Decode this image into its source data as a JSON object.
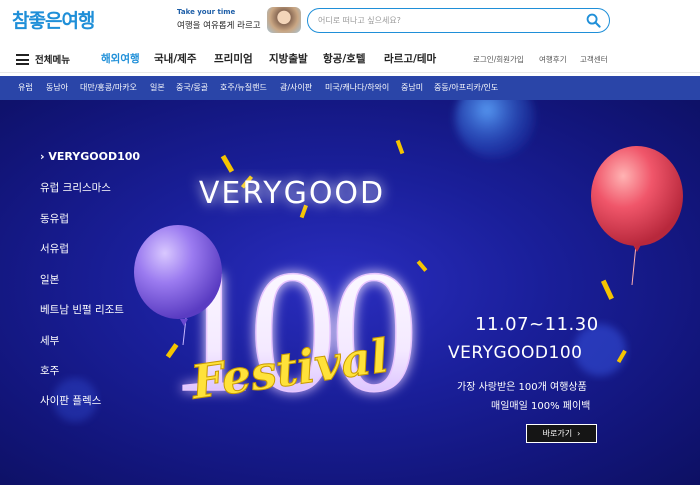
{
  "header": {
    "logo": "참좋은여행",
    "promo_small": "Take your time",
    "promo_main": "여행을 여유롭게 라르고",
    "search_placeholder": "어디로 떠나고 싶으세요?"
  },
  "nav": {
    "all_menu": "전체메뉴",
    "items": [
      {
        "label": "해외여행"
      },
      {
        "label": "국내/제주"
      },
      {
        "label": "프리미엄"
      },
      {
        "label": "지방출발"
      },
      {
        "label": "항공/호텔"
      },
      {
        "label": "라르고/테마"
      }
    ],
    "util": [
      {
        "label": "로그인/회원가입"
      },
      {
        "label": "여행후기"
      },
      {
        "label": "고객센터"
      }
    ]
  },
  "subnav": {
    "items": [
      {
        "label": "유럽"
      },
      {
        "label": "동남아"
      },
      {
        "label": "대만/홍콩/마카오"
      },
      {
        "label": "일본"
      },
      {
        "label": "중국/몽골"
      },
      {
        "label": "호주/뉴질랜드"
      },
      {
        "label": "괌/사이판"
      },
      {
        "label": "미국/캐나다/하와이"
      },
      {
        "label": "중남미"
      },
      {
        "label": "중동/아프리카/인도"
      }
    ]
  },
  "hero": {
    "side_menu": [
      {
        "label": "VERYGOOD100"
      },
      {
        "label": "유럽 크리스마스"
      },
      {
        "label": "동유럽"
      },
      {
        "label": "서유럽"
      },
      {
        "label": "일본"
      },
      {
        "label": "베트남 빈펄 리조트"
      },
      {
        "label": "세부"
      },
      {
        "label": "호주"
      },
      {
        "label": "사이판 플렉스"
      }
    ],
    "art_title": "VERYGOOD",
    "art_number": "100",
    "art_script": "Festival",
    "dates": "11.07~11.30",
    "subtitle": "VERYGOOD100",
    "desc1": "가장 사랑받은 100개 여행상품",
    "desc2": "매일매일 100% 페이백",
    "button": "바로가기"
  },
  "colors": {
    "brand_blue": "#1f8fd8",
    "subnav_bg": "#2a45a8",
    "hero_bg": "#1a1f9a"
  }
}
